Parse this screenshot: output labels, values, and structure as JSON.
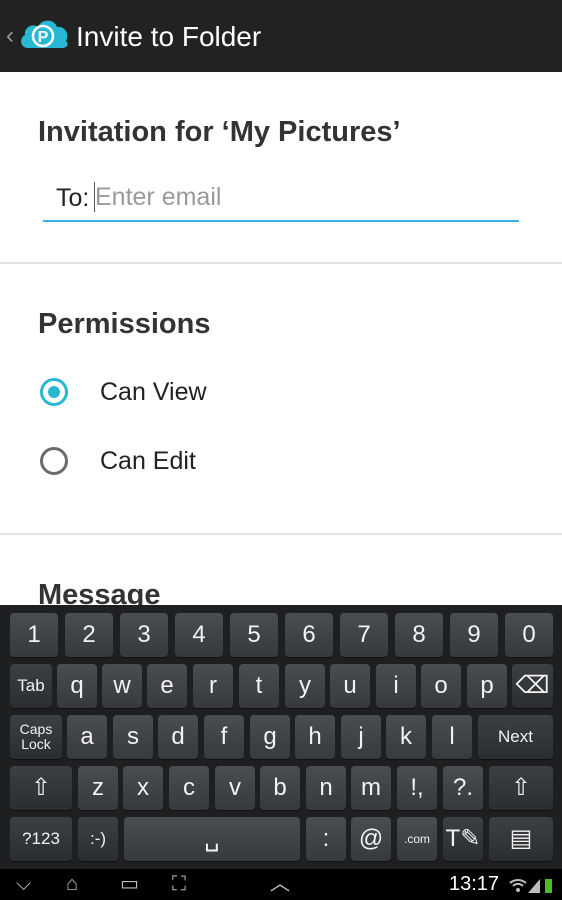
{
  "header": {
    "back_icon": "‹",
    "title": "Invite to Folder",
    "logo_letter": "P",
    "logo_color": "#29b8d3"
  },
  "invite": {
    "heading": "Invitation for ‘My Pictures’",
    "to_label": "To:",
    "email_placeholder": "Enter email",
    "email_value": ""
  },
  "permissions": {
    "heading": "Permissions",
    "options": [
      {
        "label": "Can View",
        "selected": true
      },
      {
        "label": "Can Edit",
        "selected": false
      }
    ]
  },
  "message": {
    "heading": "Message"
  },
  "keyboard": {
    "row1": [
      "1",
      "2",
      "3",
      "4",
      "5",
      "6",
      "7",
      "8",
      "9",
      "0"
    ],
    "row2": [
      "Tab",
      "q",
      "w",
      "e",
      "r",
      "t",
      "y",
      "u",
      "i",
      "o",
      "p",
      "⌫"
    ],
    "row3": [
      "Caps Lock",
      "a",
      "s",
      "d",
      "f",
      "g",
      "h",
      "j",
      "k",
      "l",
      "Next"
    ],
    "row4": [
      "⇧",
      "z",
      "x",
      "c",
      "v",
      "b",
      "n",
      "m",
      "!,",
      "?.",
      "⇧"
    ],
    "row5": [
      "?123",
      ":-)",
      "␣",
      ":",
      "@",
      ".com",
      "T✎",
      "▤"
    ]
  },
  "navbar": {
    "back_icon": "⌵",
    "home_icon": "⌂",
    "recents_icon": "▭",
    "screenshot_icon": "⛶",
    "up_icon": "︿",
    "time": "13:17"
  }
}
